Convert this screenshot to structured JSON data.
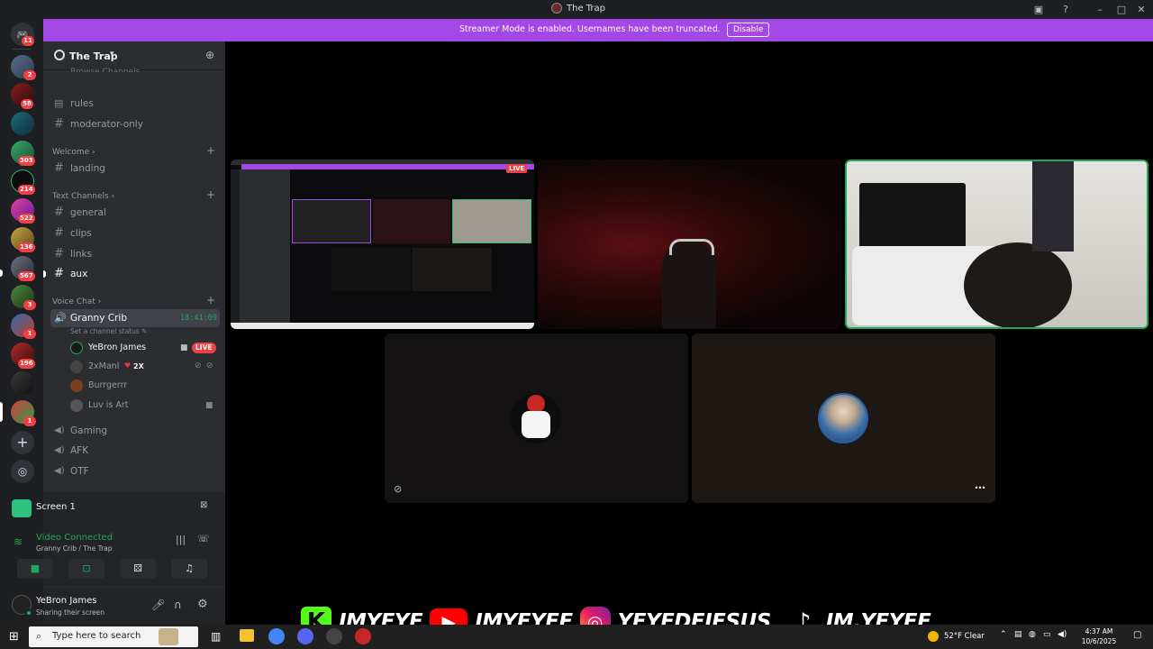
{
  "window": {
    "title": "The Trap"
  },
  "banner": {
    "text": "Streamer Mode is enabled. Usernames have been truncated.",
    "disable_label": "Disable",
    "color": "#a347e6"
  },
  "server_rail": {
    "badges": [
      "11",
      "2",
      "58",
      "303",
      "214",
      "522",
      "136",
      "567",
      "3",
      "1",
      "196",
      "1"
    ]
  },
  "server": {
    "name": "The Trap",
    "browse_label": "Browse Channels",
    "channels_top": [
      {
        "label": "rules",
        "icon": "rules-icon"
      },
      {
        "label": "moderator-only",
        "icon": "hash-icon"
      }
    ],
    "welcome_category": "Welcome",
    "welcome_channels": [
      {
        "label": "landing"
      }
    ],
    "text_category": "Text Channels",
    "text_channels": [
      {
        "label": "general"
      },
      {
        "label": "clips"
      },
      {
        "label": "links"
      },
      {
        "label": "aux"
      }
    ],
    "voice_category": "Voice Chat",
    "active_voice": {
      "label": "Granny Crib",
      "timer": "18:41:09",
      "status_placeholder": "Set a channel status"
    },
    "voice_users": [
      {
        "name": "YeBron James",
        "live": "LIVE"
      },
      {
        "name": "2xManl",
        "extra": "2X"
      },
      {
        "name": "Burrgerrr"
      },
      {
        "name": "Luv is Art"
      }
    ],
    "other_voice": [
      {
        "label": "Gaming"
      },
      {
        "label": "AFK"
      },
      {
        "label": "OTF"
      }
    ]
  },
  "screen_panel": {
    "label": "Screen 1"
  },
  "voice_panel": {
    "status": "Video Connected",
    "location": "Granny Crib / The Trap",
    "status_color": "#23a55a"
  },
  "user_panel": {
    "name": "YeBron James",
    "status": "Sharing their screen"
  },
  "stream_preview": {
    "live_label": "LIVE"
  },
  "overlay": {
    "kick": "IMYEYE",
    "youtube": "IMYEYEE",
    "instagram": "YEYEDEJESUS_",
    "tiktok": "IM.YEYEE"
  },
  "taskbar": {
    "search_placeholder": "Type here to search",
    "weather": "52°F  Clear",
    "time": "4:37 AM",
    "date": "10/6/2025"
  }
}
